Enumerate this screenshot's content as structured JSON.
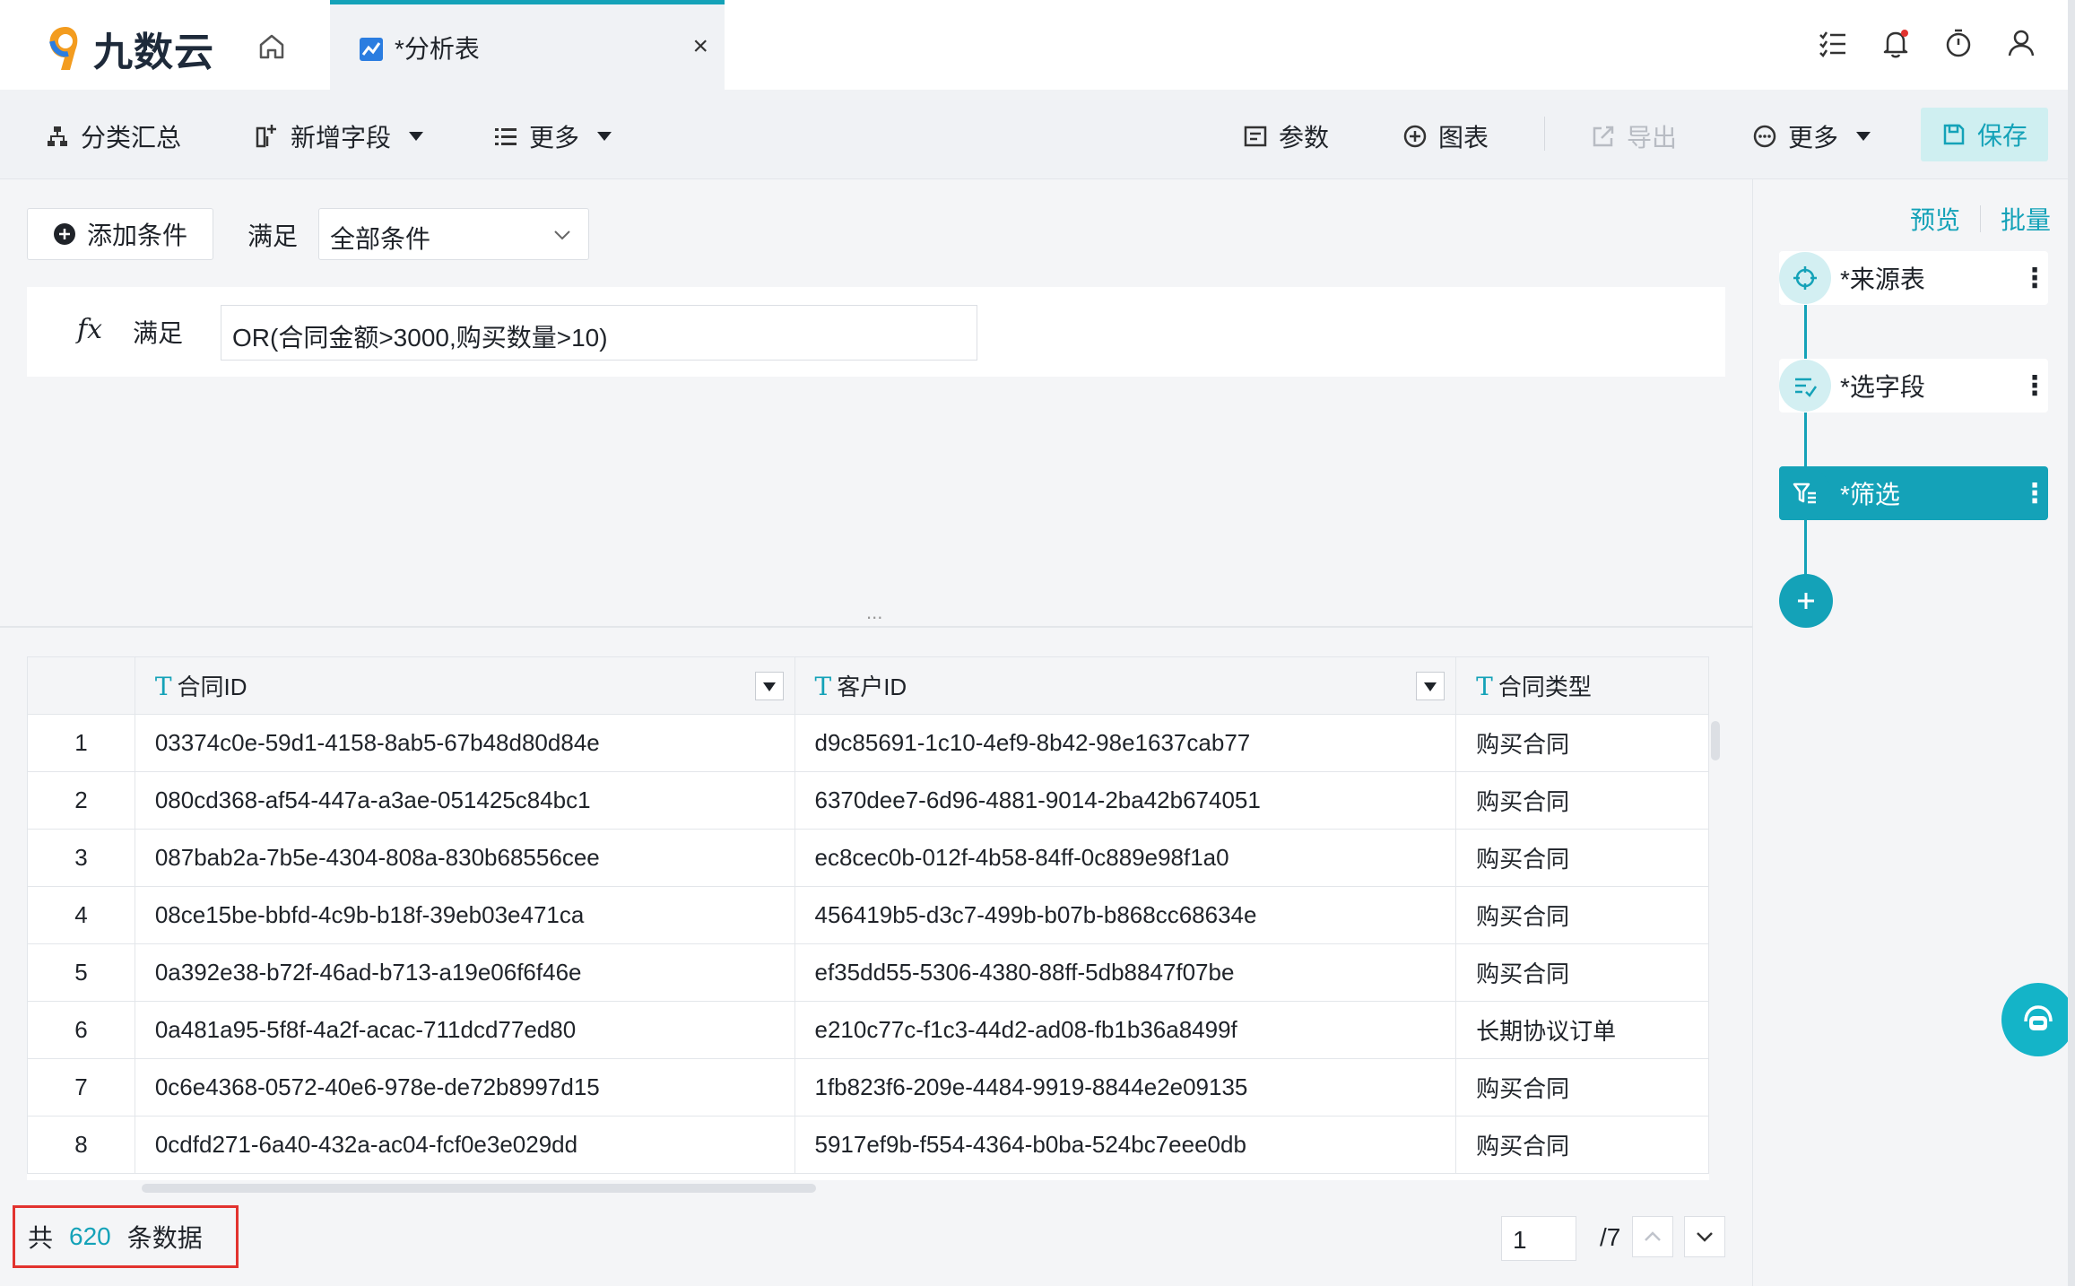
{
  "app": {
    "logo_text": "九数云"
  },
  "tab": {
    "label": "*分析表",
    "close": "×"
  },
  "toolbar": {
    "group_summary": "分类汇总",
    "add_field": "新增字段",
    "more_left": "更多",
    "params": "参数",
    "chart": "图表",
    "export": "导出",
    "more_right": "更多",
    "save": "保存"
  },
  "filter": {
    "add_condition": "添加条件",
    "satisfy_label": "满足",
    "match_mode": "全部条件",
    "fx_label": "fx",
    "formula_satisfy": "满足",
    "formula": "OR(合同金额>3000,购买数量>10)"
  },
  "splitter_dots": "...",
  "table": {
    "columns": [
      {
        "type": "T",
        "name": "合同ID"
      },
      {
        "type": "T",
        "name": "客户ID"
      },
      {
        "type": "T",
        "name": "合同类型"
      }
    ],
    "rows": [
      {
        "idx": "1",
        "contract_id": "03374c0e-59d1-4158-8ab5-67b48d80d84e",
        "customer_id": "d9c85691-1c10-4ef9-8b42-98e1637cab77",
        "type": "购买合同"
      },
      {
        "idx": "2",
        "contract_id": "080cd368-af54-447a-a3ae-051425c84bc1",
        "customer_id": "6370dee7-6d96-4881-9014-2ba42b674051",
        "type": "购买合同"
      },
      {
        "idx": "3",
        "contract_id": "087bab2a-7b5e-4304-808a-830b68556cee",
        "customer_id": "ec8cec0b-012f-4b58-84ff-0c889e98f1a0",
        "type": "购买合同"
      },
      {
        "idx": "4",
        "contract_id": "08ce15be-bbfd-4c9b-b18f-39eb03e471ca",
        "customer_id": "456419b5-d3c7-499b-b07b-b868cc68634e",
        "type": "购买合同"
      },
      {
        "idx": "5",
        "contract_id": "0a392e38-b72f-46ad-b713-a19e06f6f46e",
        "customer_id": "ef35dd55-5306-4380-88ff-5db8847f07be",
        "type": "购买合同"
      },
      {
        "idx": "6",
        "contract_id": "0a481a95-5f8f-4a2f-acac-711dcd77ed80",
        "customer_id": "e210c77c-f1c3-44d2-ad08-fb1b36a8499f",
        "type": "长期协议订单"
      },
      {
        "idx": "7",
        "contract_id": "0c6e4368-0572-40e6-978e-de72b8997d15",
        "customer_id": "1fb823f6-209e-4484-9919-8844e2e09135",
        "type": "购买合同"
      },
      {
        "idx": "8",
        "contract_id": "0cdfd271-6a40-432a-ac04-fcf0e3e029dd",
        "customer_id": "5917ef9b-f554-4364-b0ba-524bc7eee0db",
        "type": "购买合同"
      }
    ]
  },
  "footer": {
    "total_prefix": "共",
    "total_count": "620",
    "total_suffix": "条数据",
    "page_current": "1",
    "page_total": "/7"
  },
  "steps_panel": {
    "preview": "预览",
    "batch": "批量",
    "steps": [
      {
        "label": "*来源表",
        "icon": "crosshair-icon"
      },
      {
        "label": "*选字段",
        "icon": "field-select-icon"
      },
      {
        "label": "*筛选",
        "icon": "filter-icon",
        "active": true
      }
    ]
  },
  "colors": {
    "accent": "#14a2b8",
    "highlight_border": "#e2332f"
  }
}
